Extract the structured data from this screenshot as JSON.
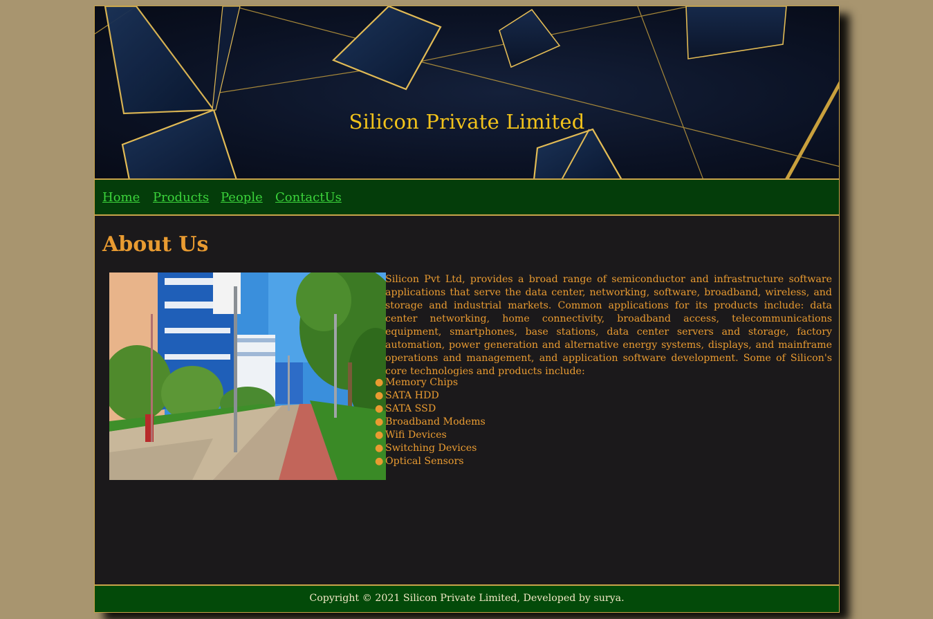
{
  "banner": {
    "title": "Silicon Private Limited"
  },
  "nav": {
    "items": [
      {
        "label": "Home"
      },
      {
        "label": "Products"
      },
      {
        "label": "People"
      },
      {
        "label": "ContactUs"
      }
    ]
  },
  "main": {
    "heading": "About Us",
    "image_icon": "campus-photo",
    "description": "Silicon Pvt Ltd, provides a broad range of semiconductor and infrastructure software applications that serve the data center, networking, software, broadband, wireless, and storage and industrial markets. Common applications for its products include: data center networking, home connectivity, broadband access, telecommunications equipment, smartphones, base stations, data center servers and storage, factory automation, power generation and alternative energy systems, displays, and mainframe operations and management, and application software development. Some of Silicon's core technologies and products include:",
    "technologies": [
      "Memory Chips",
      "SATA HDD",
      "SATA SSD",
      "Broadband Modems",
      "Wifi Devices",
      "Switching Devices",
      "Optical Sensors"
    ],
    "bullet": "●"
  },
  "footer": {
    "text": "Copyright © 2021 Silicon Private Limited, Developed by surya."
  },
  "colors": {
    "page_background": "#a8956f",
    "banner_title": "#f2c31b",
    "nav_background": "#043d0a",
    "nav_link": "#3bd33b",
    "content_background": "#1b191b",
    "content_text": "#e99b31",
    "footer_background": "#034a09",
    "border_gold": "#c9a44a"
  }
}
